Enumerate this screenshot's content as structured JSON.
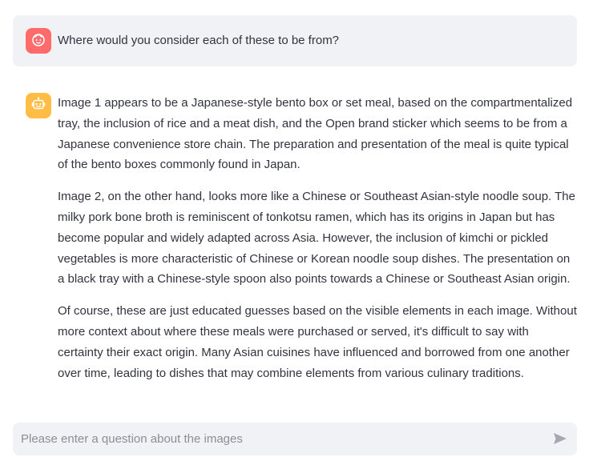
{
  "user_message": {
    "text": "Where would you consider each of these to be from?",
    "avatar_icon": "face-icon",
    "avatar_color": "#ff6b6b"
  },
  "assistant_message": {
    "avatar_icon": "robot-icon",
    "avatar_color": "#ffbd45",
    "paragraphs": [
      "Image 1 appears to be a Japanese-style bento box or set meal, based on the compartmentalized tray, the inclusion of rice and a meat dish, and the Open brand sticker which seems to be from a Japanese convenience store chain. The preparation and presentation of the meal is quite typical of the bento boxes commonly found in Japan.",
      "Image 2, on the other hand, looks more like a Chinese or Southeast Asian-style noodle soup. The milky pork bone broth is reminiscent of tonkotsu ramen, which has its origins in Japan but has become popular and widely adapted across Asia. However, the inclusion of kimchi or pickled vegetables is more characteristic of Chinese or Korean noodle soup dishes. The presentation on a black tray with a Chinese-style spoon also points towards a Chinese or Southeast Asian origin.",
      "Of course, these are just educated guesses based on the visible elements in each image. Without more context about where these meals were purchased or served, it's difficult to say with certainty their exact origin. Many Asian cuisines have influenced and borrowed from one another over time, leading to dishes that may combine elements from various culinary traditions."
    ]
  },
  "chat_input": {
    "placeholder": "Please enter a question about the images",
    "value": "",
    "send_icon": "send-icon"
  }
}
